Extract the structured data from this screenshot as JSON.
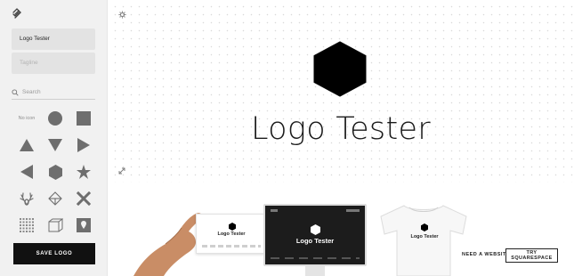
{
  "sidebar": {
    "name_field": {
      "value": "Logo Tester"
    },
    "tagline_field": {
      "placeholder": "Tagline"
    },
    "search": {
      "placeholder": "Search"
    },
    "icons": {
      "no_icon_label": "No icon",
      "items": [
        "no-icon",
        "circle",
        "square",
        "triangle-up",
        "triangle-down",
        "triangle-right",
        "triangle-left",
        "hexagon",
        "star",
        "antlers",
        "diamond-outline",
        "x-cross",
        "dot-grid",
        "cube-outline",
        "map-pin-square"
      ]
    },
    "save_button": "SAVE LOGO"
  },
  "canvas": {
    "title": "Logo Tester",
    "logo_icon": "hexagon",
    "accent_color": "#000000"
  },
  "mockups": {
    "business_card_name": "Logo Tester",
    "screen_name": "Logo Tester",
    "tshirt_name": "Logo Tester"
  },
  "footer": {
    "need_website": "NEED A WEBSITE?",
    "try_button": "TRY SQUARESPACE"
  }
}
